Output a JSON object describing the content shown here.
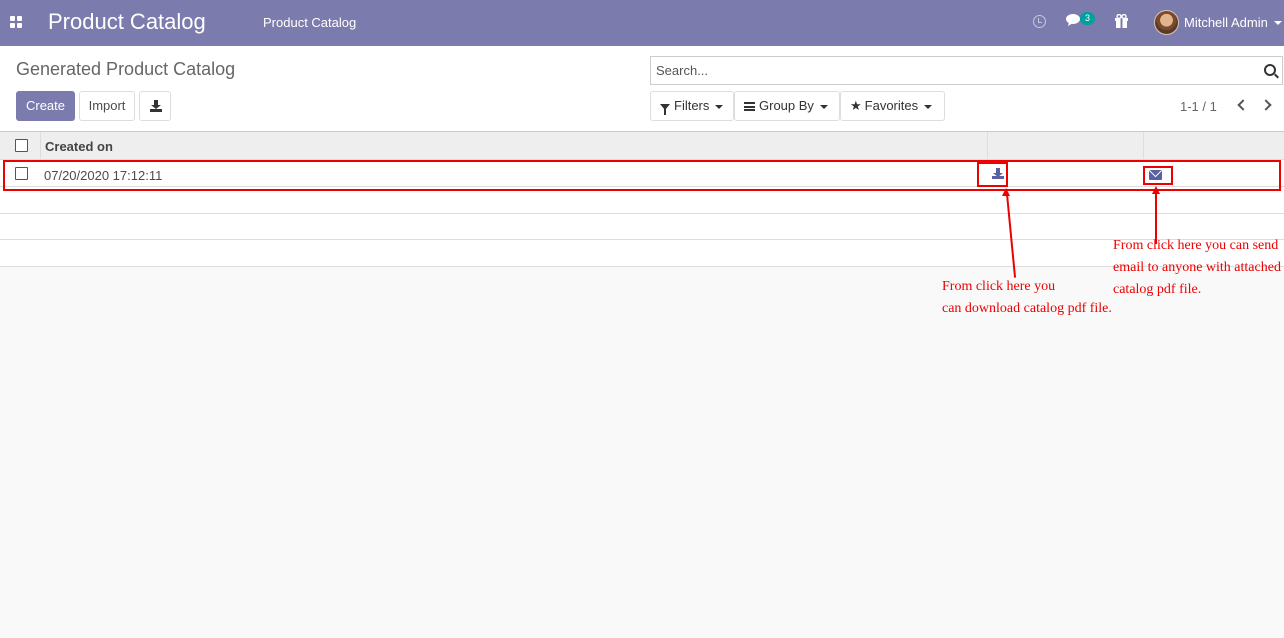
{
  "navbar": {
    "brand": "Product Catalog",
    "menu_link": "Product Catalog",
    "messages_count": "3",
    "user_name": "Mitchell Admin"
  },
  "control_panel": {
    "breadcrumb": "Generated Product Catalog",
    "create_label": "Create",
    "import_label": "Import",
    "search_placeholder": "Search...",
    "filters_label": "Filters",
    "group_by_label": "Group By",
    "favorites_label": "Favorites",
    "pager": "1-1 / 1"
  },
  "table": {
    "columns": [
      "Created on",
      "",
      ""
    ],
    "rows": [
      {
        "created_on": "07/20/2020 17:12:11"
      }
    ]
  },
  "annotations": {
    "download_note_line1": "From click here you",
    "download_note_line2": "can download catalog pdf file.",
    "email_note_line1": "From click here you can send",
    "email_note_line2": "email to anyone with attached",
    "email_note_line3": "catalog pdf file."
  },
  "colors": {
    "brand": "#7c7bad",
    "annotation": "#ee0000",
    "icon": "#5b5fa4"
  },
  "icons": [
    "apps-icon",
    "clock-icon",
    "chat-icon",
    "gift-icon",
    "download-icon",
    "search-icon",
    "filter-icon",
    "list-icon",
    "star-icon",
    "chevron-left-icon",
    "chevron-right-icon",
    "envelope-icon"
  ]
}
